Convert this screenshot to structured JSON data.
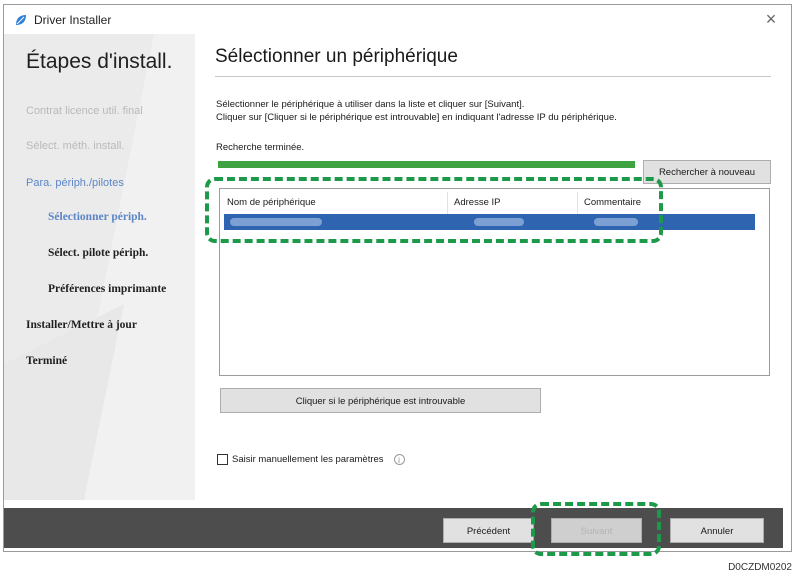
{
  "window": {
    "title": "Driver Installer",
    "close_glyph": "×",
    "icon": "app-leaf-icon"
  },
  "sidebar": {
    "title": "Étapes d'install.",
    "steps": [
      {
        "label": "Contrat licence util. final",
        "state": "done"
      },
      {
        "label": "Sélect. méth. install.",
        "state": "done"
      },
      {
        "label": "Para. périph./pilotes",
        "state": "active-parent"
      },
      {
        "label": "Sélectionner périph.",
        "state": "current"
      },
      {
        "label": "Sélect. pilote périph.",
        "state": "todo"
      },
      {
        "label": "Préférences imprimante",
        "state": "todo"
      },
      {
        "label": "Installer/Mettre à jour",
        "state": "todo"
      },
      {
        "label": "Terminé",
        "state": "todo"
      }
    ]
  },
  "main": {
    "title": "Sélectionner un périphérique",
    "instruction_line1": "Sélectionner le périphérique à utiliser dans la liste et cliquer sur [Suivant].",
    "instruction_line2": "Cliquer sur [Cliquer si le périphérique est introuvable] en indiquant l'adresse IP du périphérique.",
    "search_status": "Recherche terminée.",
    "progress_percent": 100,
    "research_button": "Rechercher à nouveau",
    "table": {
      "columns": [
        "Nom de périphérique",
        "Adresse IP",
        "Commentaire"
      ]
    },
    "not_found_button": "Cliquer si le périphérique est introuvable",
    "manual_checkbox_label": "Saisir manuellement les paramètres",
    "manual_checkbox_checked": false
  },
  "footer": {
    "prev_button": "Précédent",
    "next_button": "Suivant",
    "cancel_button": "Annuler"
  },
  "image_code": "D0CZDM0202",
  "colors": {
    "highlight": "#1c9a4a",
    "progress": "#3fa341",
    "selection": "#2f64b1",
    "footer": "#4d4d4d"
  }
}
